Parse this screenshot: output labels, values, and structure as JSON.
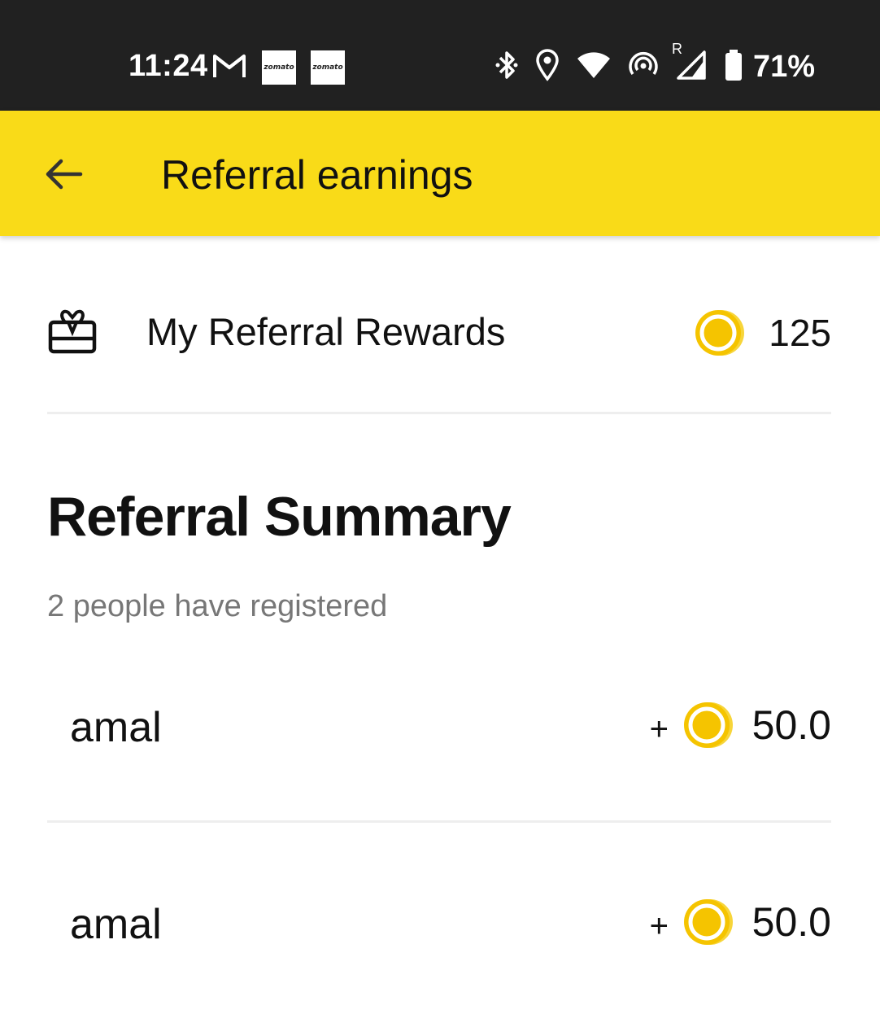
{
  "status_bar": {
    "time": "11:24",
    "notification_icons": [
      "gmail-icon",
      "zomato-icon",
      "zomato-icon"
    ],
    "zomato_label": "zomato",
    "system_icons": [
      "bluetooth-icon",
      "location-icon",
      "wifi-icon",
      "hotspot-icon",
      "signal-icon",
      "battery-icon"
    ],
    "signal_roaming": "R",
    "battery_percent": "71%"
  },
  "app_bar": {
    "title": "Referral earnings",
    "back_icon": "arrow-left-icon",
    "background_color": "#f9db18"
  },
  "rewards": {
    "icon": "gift-card-icon",
    "label": "My Referral Rewards",
    "coin_icon": "coin-icon",
    "value": "125",
    "coin_color": "#f5c400"
  },
  "summary": {
    "title": "Referral Summary",
    "subtitle": "2 people have registered",
    "referrals": [
      {
        "name": "amal",
        "sign": "+",
        "amount": "50.0"
      },
      {
        "name": "amal",
        "sign": "+",
        "amount": "50.0"
      }
    ]
  }
}
